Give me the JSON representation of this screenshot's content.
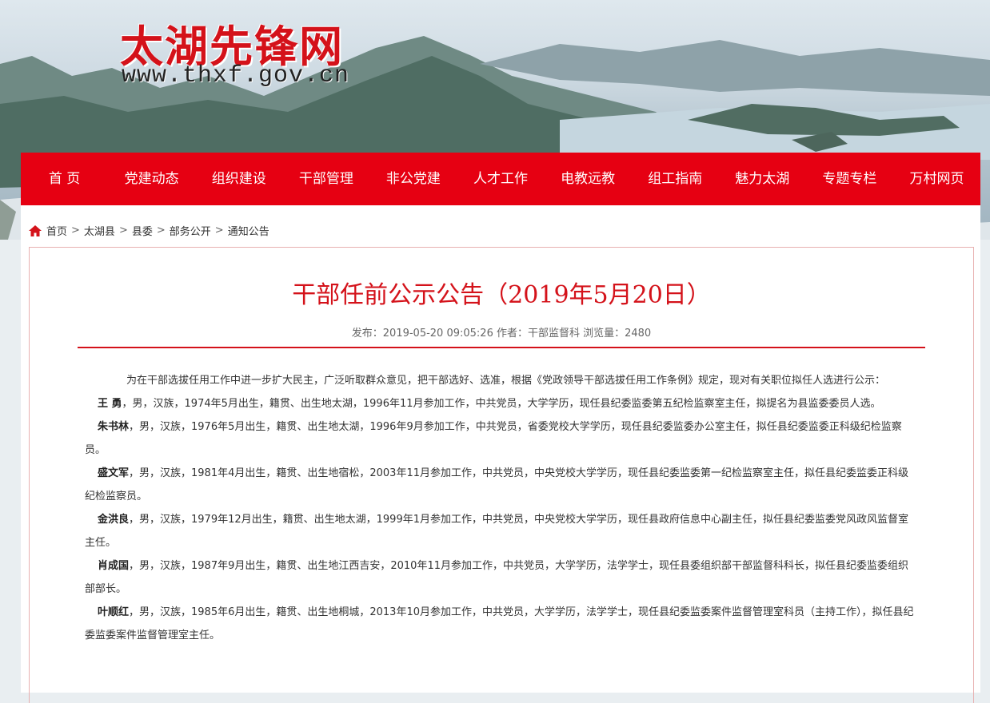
{
  "site": {
    "logo_text": "太湖先锋网",
    "logo_url": "www.thxf.gov.cn"
  },
  "nav": [
    "首 页",
    "党建动态",
    "组织建设",
    "干部管理",
    "非公党建",
    "人才工作",
    "电教远教",
    "组工指南",
    "魅力太湖",
    "专题专栏",
    "万村网页"
  ],
  "breadcrumb": [
    "首页",
    "太湖县",
    "县委",
    "部务公开",
    "通知公告"
  ],
  "article": {
    "title": "干部任前公示公告（2019年5月20日）",
    "meta": "发布：2019-05-20 09:05:26 作者：干部监督科 浏览量：2480",
    "intro": "为在干部选拔任用工作中进一步扩大民主，广泛听取群众意见，把干部选好、选准，根据《党政领导干部选拔任用工作条例》规定，现对有关职位拟任人选进行公示：",
    "people": [
      {
        "name": "王 勇",
        "text": "，男，汉族，1974年5月出生，籍贯、出生地太湖，1996年11月参加工作，中共党员，大学学历，现任县纪委监委第五纪检监察室主任，拟提名为县监委委员人选。"
      },
      {
        "name": "朱书林",
        "text": "，男，汉族，1976年5月出生，籍贯、出生地太湖，1996年9月参加工作，中共党员，省委党校大学学历，现任县纪委监委办公室主任，拟任县纪委监委正科级纪检监察员。"
      },
      {
        "name": "盛文军",
        "text": "，男，汉族，1981年4月出生，籍贯、出生地宿松，2003年11月参加工作，中共党员，中央党校大学学历，现任县纪委监委第一纪检监察室主任，拟任县纪委监委正科级纪检监察员。"
      },
      {
        "name": "金洪良",
        "text": "，男，汉族，1979年12月出生，籍贯、出生地太湖，1999年1月参加工作，中共党员，中央党校大学学历，现任县政府信息中心副主任，拟任县纪委监委党风政风监督室主任。"
      },
      {
        "name": "肖成国",
        "text": "，男，汉族，1987年9月出生，籍贯、出生地江西吉安，2010年11月参加工作，中共党员，大学学历，法学学士，现任县委组织部干部监督科科长，拟任县纪委监委组织部部长。"
      },
      {
        "name": "叶顺红",
        "text": "，男，汉族，1985年6月出生，籍贯、出生地桐城，2013年10月参加工作，中共党员，大学学历，法学学士，现任县纪委监委案件监督管理室科员（主持工作），拟任县纪委监委案件监督管理室主任。"
      }
    ]
  },
  "colors": {
    "brand_red": "#e60012",
    "title_red": "#d4121a"
  }
}
